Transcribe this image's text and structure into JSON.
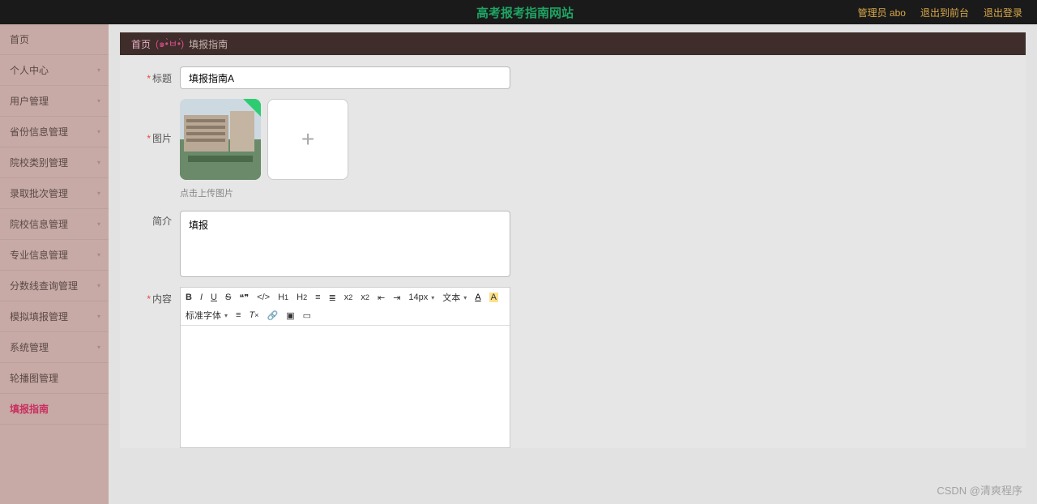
{
  "header": {
    "site_title": "高考报考指南网站",
    "admin_label": "管理员 abo",
    "to_front": "退出到前台",
    "logout": "退出登录"
  },
  "sidebar": {
    "items": [
      {
        "label": "首页",
        "expandable": false
      },
      {
        "label": "个人中心",
        "expandable": true
      },
      {
        "label": "用户管理",
        "expandable": true
      },
      {
        "label": "省份信息管理",
        "expandable": true
      },
      {
        "label": "院校类别管理",
        "expandable": true
      },
      {
        "label": "录取批次管理",
        "expandable": true
      },
      {
        "label": "院校信息管理",
        "expandable": true
      },
      {
        "label": "专业信息管理",
        "expandable": true
      },
      {
        "label": "分数线查询管理",
        "expandable": true
      },
      {
        "label": "模拟填报管理",
        "expandable": true
      },
      {
        "label": "系统管理",
        "expandable": true
      },
      {
        "label": "轮播图管理",
        "expandable": false
      },
      {
        "label": "填报指南",
        "expandable": false,
        "active": true
      }
    ]
  },
  "breadcrumb": {
    "home": "首页",
    "face": "(๑•̀ㅂ•́)",
    "current": "填报指南"
  },
  "form": {
    "title_label": "标题",
    "title_value": "填报指南A",
    "image_label": "图片",
    "upload_hint": "点击上传图片",
    "intro_label": "简介",
    "intro_value": "填报",
    "content_label": "内容"
  },
  "editor": {
    "font_size": "14px",
    "text_type": "文本",
    "font_family": "标准字体"
  },
  "watermark": "CSDN @清爽程序"
}
